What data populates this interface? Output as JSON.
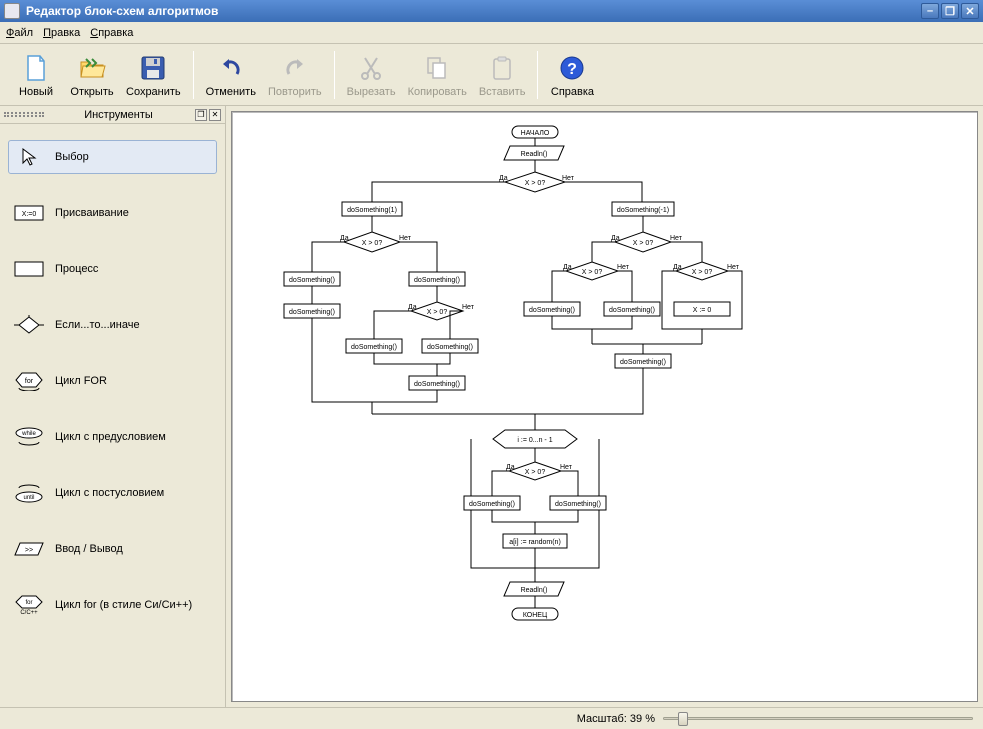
{
  "title": "Редактор блок-схем алгоритмов",
  "menu": {
    "file": "Файл",
    "edit": "Правка",
    "help": "Справка"
  },
  "toolbar": {
    "new": "Новый",
    "open": "Открыть",
    "save": "Сохранить",
    "undo": "Отменить",
    "redo": "Повторить",
    "cut": "Вырезать",
    "copy": "Копировать",
    "paste": "Вставить",
    "help": "Справка"
  },
  "tools_panel": {
    "title": "Инструменты",
    "items": [
      {
        "label": "Выбор"
      },
      {
        "label": "Присваивание"
      },
      {
        "label": "Процесс"
      },
      {
        "label": "Если...то...иначе"
      },
      {
        "label": "Цикл FOR"
      },
      {
        "label": "Цикл с предусловием"
      },
      {
        "label": "Цикл с постусловием"
      },
      {
        "label": "Ввод / Вывод"
      },
      {
        "label": "Цикл for (в стиле Си/Си++)"
      }
    ]
  },
  "flowchart": {
    "begin": "НАЧАЛО",
    "end": "КОНЕЦ",
    "readln": "Readln()",
    "cond": "X > 0?",
    "yes": "Да",
    "no": "Нет",
    "do1": "doSomething(1)",
    "dom1": "doSomething(-1)",
    "do": "doSomething()",
    "xzero": "X := 0",
    "forhead": "i := 0...n - 1",
    "arr": "a[i] := random(n)"
  },
  "status": {
    "zoom_label": "Масштаб: 39 %"
  }
}
